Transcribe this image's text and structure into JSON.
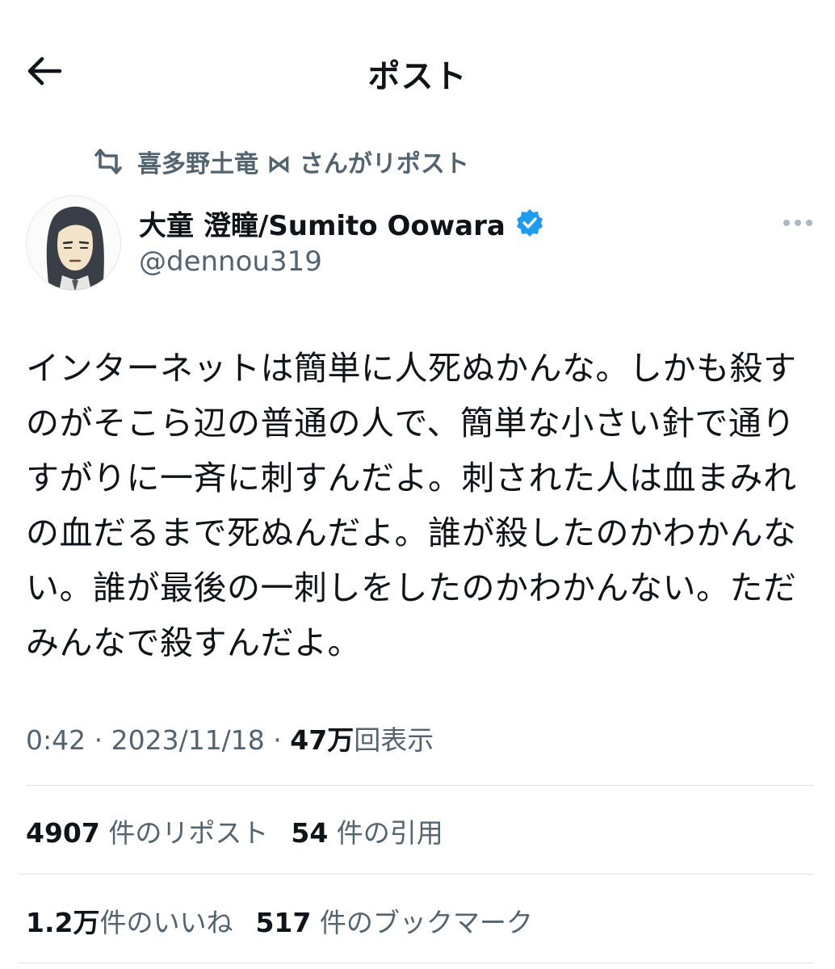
{
  "header": {
    "title": "ポスト"
  },
  "repost": {
    "text": "喜多野土竜 ⋈ さんがリポスト"
  },
  "author": {
    "name": "大童 澄瞳/Sumito Oowara",
    "handle": "@dennou319",
    "verified": true
  },
  "tweet": {
    "text": "インターネットは簡単に人死ぬかんな。しかも殺すのがそこら辺の普通の人で、簡単な小さい針で通りすがりに一斉に刺すんだよ。刺された人は血まみれの血だるまで死ぬんだよ。誰が殺したのかわかんない。誰が最後の一刺しをしたのかわかんない。ただみんなで殺すんだよ。"
  },
  "meta": {
    "time": "0:42",
    "date": "2023/11/18",
    "views_count": "47万",
    "views_label": "回表示"
  },
  "stats": {
    "reposts_count": "4907",
    "reposts_label": "件のリポスト",
    "quotes_count": "54",
    "quotes_label": "件の引用",
    "likes_count": "1.2万",
    "likes_label": "件のいいね",
    "bookmarks_count": "517",
    "bookmarks_label": "件のブックマーク"
  },
  "colors": {
    "text": "#0f1419",
    "secondary": "#536471",
    "verified": "#1d9bf0",
    "divider": "#dfe3e6"
  }
}
